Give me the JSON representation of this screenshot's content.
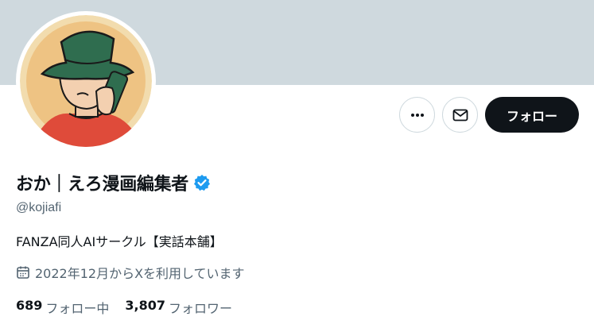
{
  "profile": {
    "display_name": "おか｜えろ漫画編集者",
    "handle": "@kojiafi",
    "bio": "FANZA同人AIサークル【実話本舗】",
    "joined": "2022年12月からXを利用しています",
    "verified": true
  },
  "actions": {
    "more_icon": "more-horizontal-icon",
    "message_icon": "envelope-icon",
    "follow_label": "フォロー"
  },
  "stats": {
    "following_count": "689",
    "following_label": "フォロー中",
    "followers_count": "3,807",
    "followers_label": "フォロワー"
  },
  "colors": {
    "banner": "#cfd9de",
    "follow_button": "#0f1419",
    "verified_blue": "#1d9bf0",
    "secondary_text": "#536471"
  }
}
